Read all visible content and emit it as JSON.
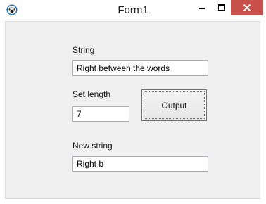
{
  "window": {
    "title": "Form1",
    "icons": {
      "app": "paw-icon",
      "minimize": "minimize-icon",
      "maximize": "maximize-icon",
      "close": "close-icon"
    },
    "colors": {
      "close_button": "#c7504a",
      "client_bg": "#f0f0f0",
      "focus_border": "#3c7fb1"
    }
  },
  "form": {
    "string_label": "String",
    "string_value": "Right between the words",
    "length_label": "Set length",
    "length_value": "7",
    "output_button": "Output",
    "new_string_label": "New string",
    "new_string_value": "Right b"
  }
}
